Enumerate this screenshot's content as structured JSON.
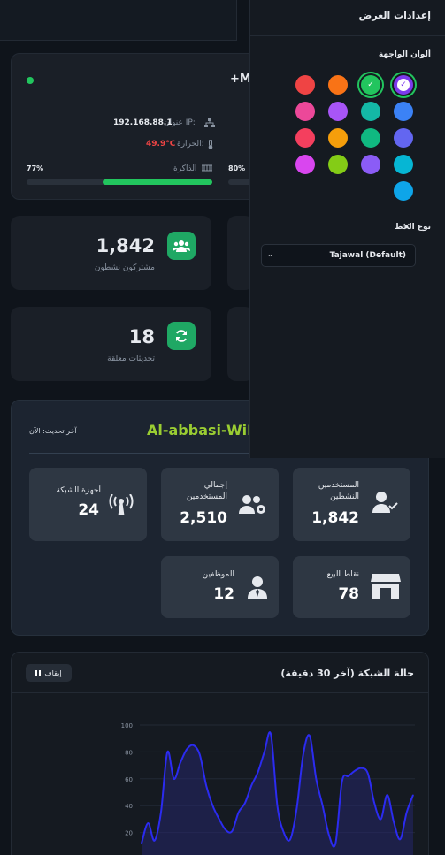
{
  "device": {
    "name_partial": "+MI",
    "ip_label": "عنوان IP:",
    "ip_value": "192.168.88.1",
    "temp_label": "الحرارة:",
    "temp_value": "49.9°C",
    "memory_label": "الذاكرة",
    "memory_percent": "77%",
    "memory_fraction": 0.77,
    "cpu_percent": "80%",
    "cpu_fraction": 0.8
  },
  "stats": {
    "active_subscribers_value": "1,842",
    "active_subscribers_label": "مشتركون نشطون",
    "pending_updates_value": "18",
    "pending_updates_label": "تحديثات معلقة"
  },
  "settings_panel": {
    "title": "إعدادات العرض",
    "colors_title": "ألوان الواجهة",
    "font_title": "نوع الخط",
    "font_select_value": "Tajawal (Default)",
    "swatches": [
      "#7c3aed",
      "#22c55e",
      "#f97316",
      "#ef4444",
      "#3b82f6",
      "#14b8a6",
      "#a855f7",
      "#ec4899",
      "#6366f1",
      "#10b981",
      "#f59e0b",
      "#f43f5e",
      "#06b6d4",
      "#8b5cf6",
      "#84cc16",
      "#d946ef",
      "#0ea5e9"
    ]
  },
  "wifi": {
    "brand": "Al-abbasi-WiFi",
    "brand_color": "#9acd32",
    "last_update": "آخر تحديث: الآن",
    "tiles": {
      "active_users_label": "المستخدمين النشطين",
      "active_users_value": "1,842",
      "total_users_label": "إجمالي المستخدمين",
      "total_users_value": "2,510",
      "network_devices_label": "أجهزة الشبكة",
      "network_devices_value": "24",
      "pos_label": "نقاط البيع",
      "pos_value": "78",
      "employees_label": "الموظفين",
      "employees_value": "12"
    }
  },
  "chart_card": {
    "title": "حالة الشبكة (آخر 30 دقيقة)",
    "pause_label": "إيقاف"
  },
  "chart_data": {
    "type": "area",
    "yticks": [
      "100",
      "80",
      "60",
      "40",
      "20"
    ],
    "ylim": [
      0,
      100
    ],
    "values": [
      12,
      27,
      14,
      35,
      80,
      60,
      72,
      82,
      85,
      78,
      55,
      40,
      30,
      22,
      21,
      35,
      42,
      55,
      65,
      80,
      93,
      40,
      20,
      15,
      38,
      78,
      92,
      60,
      40,
      18,
      12,
      58,
      62,
      66,
      68,
      64,
      42,
      30,
      48,
      28,
      15,
      35,
      48
    ]
  }
}
